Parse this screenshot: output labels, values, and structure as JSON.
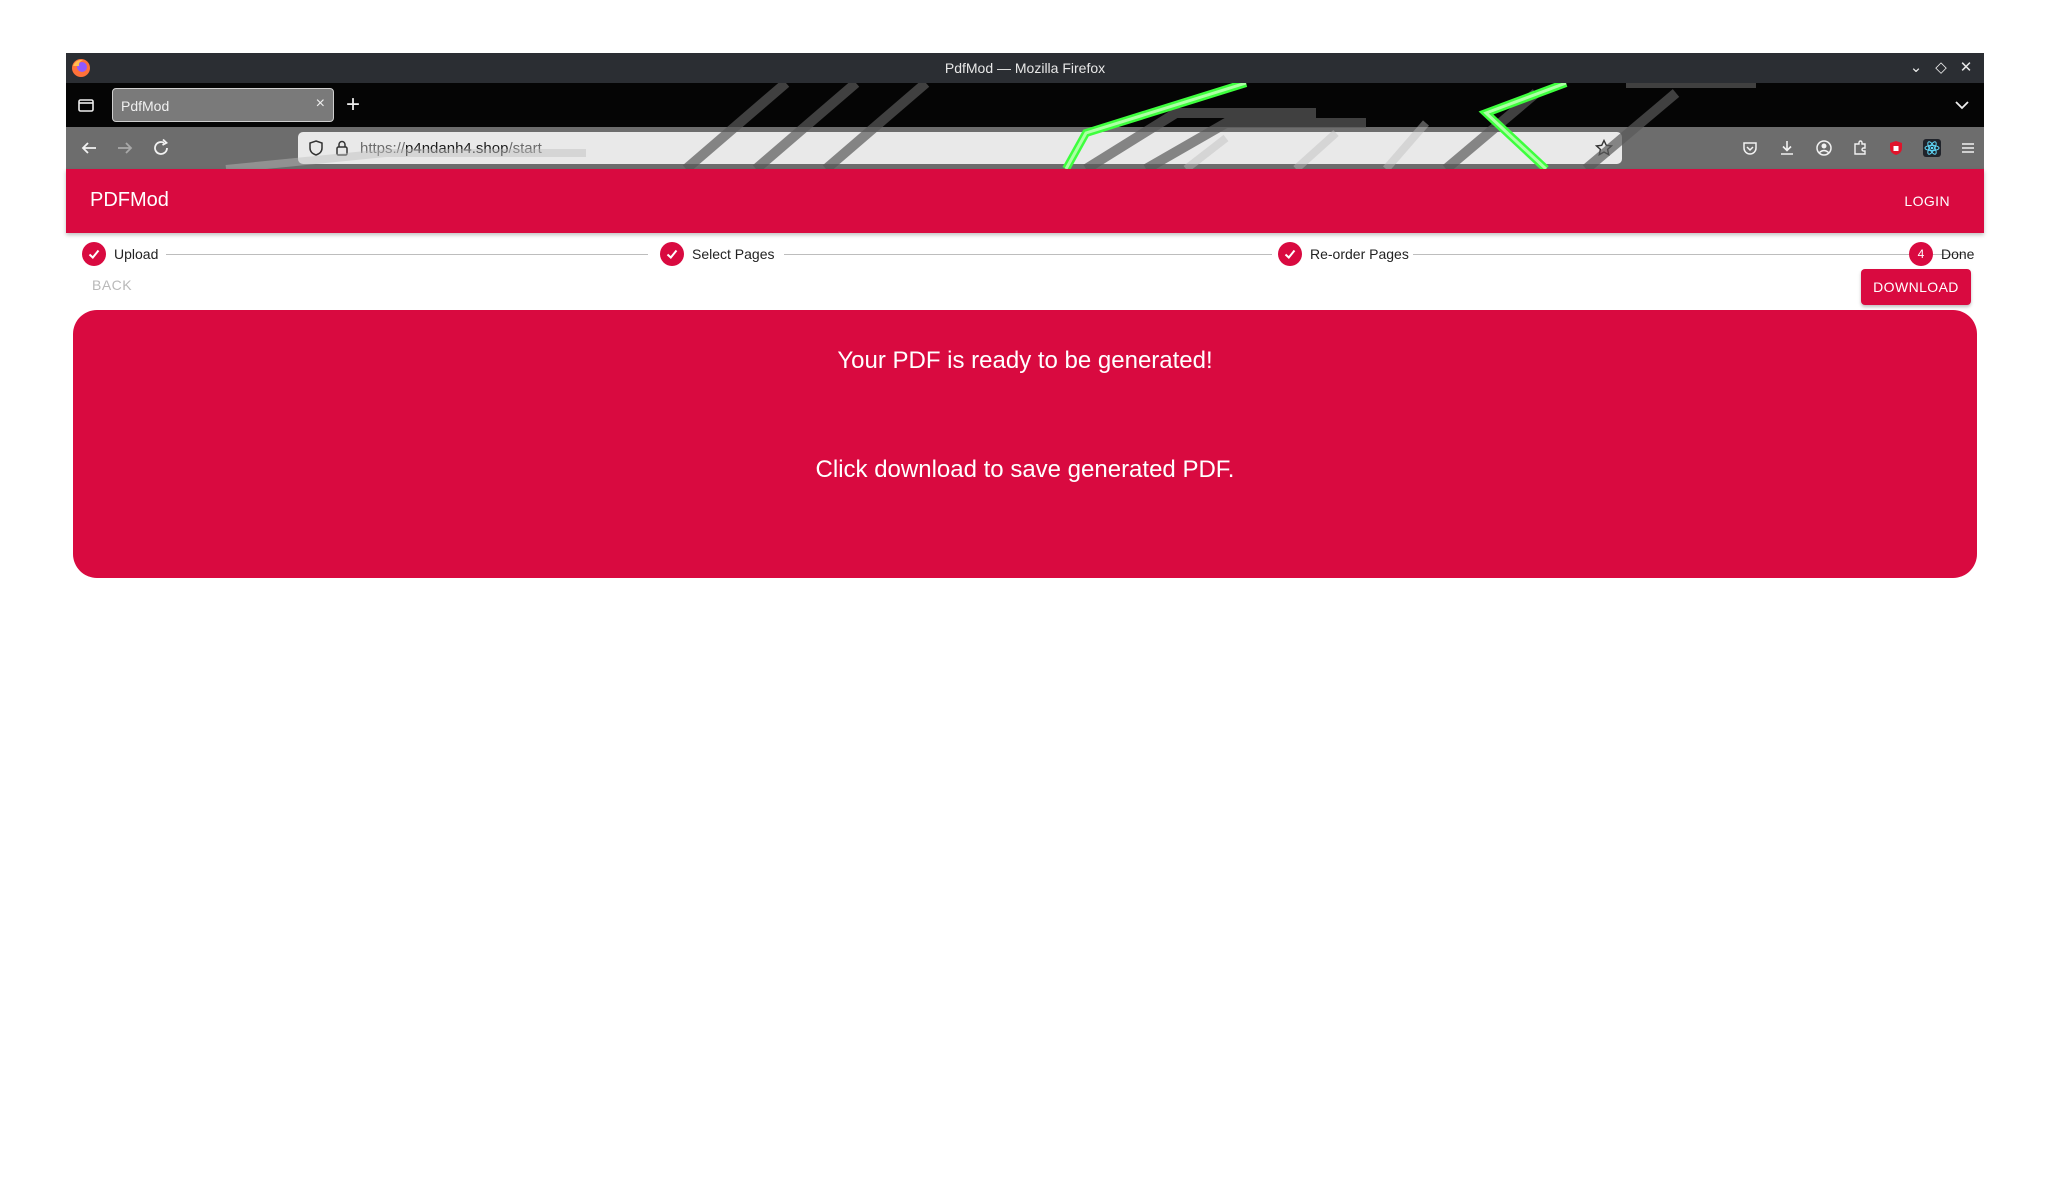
{
  "window": {
    "title": "PdfMod — Mozilla Firefox"
  },
  "browser": {
    "tab": {
      "label": "PdfMod",
      "close": "×"
    },
    "new_tab": "+",
    "url": {
      "scheme": "https://",
      "host": "p4ndanh4.shop",
      "path": "/start"
    }
  },
  "app": {
    "brand": "PDFMod",
    "login": "LOGIN",
    "accent_color": "#d90a40",
    "steps": [
      {
        "label": "Upload",
        "status": "complete"
      },
      {
        "label": "Select Pages",
        "status": "complete"
      },
      {
        "label": "Re-order Pages",
        "status": "complete"
      },
      {
        "label": "Done",
        "number": "4",
        "status": "active"
      }
    ],
    "back": "BACK",
    "download": "DOWNLOAD",
    "message_1": "Your PDF is ready to be generated!",
    "message_2": "Click download to save generated PDF."
  }
}
